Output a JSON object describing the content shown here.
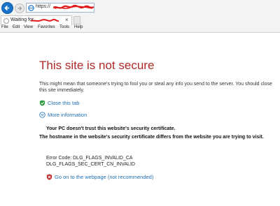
{
  "browser": {
    "url_prefix": "https://",
    "tab_label": "Waiting for",
    "tab_close": "×",
    "menu": [
      "File",
      "Edit",
      "View",
      "Favorites",
      "Tools",
      "Help"
    ]
  },
  "page": {
    "title": "This site is not secure",
    "description": "This might mean that someone's trying to fool you or steal any info you send to the server. You should close this site immediately.",
    "close_tab": "Close this tab",
    "more_info": "More information",
    "warning_line1": "Your PC doesn't trust this website's security certificate.",
    "warning_line2": "The hostname in the website's security certificate differs from the website you are trying to visit.",
    "error_code_line1": "Error Code: DLG_FLAGS_INVALID_CA",
    "error_code_line2": "DLG_FLAGS_SEC_CERT_CN_INVALID",
    "go_on": "Go on to the webpage (not recommended)"
  }
}
